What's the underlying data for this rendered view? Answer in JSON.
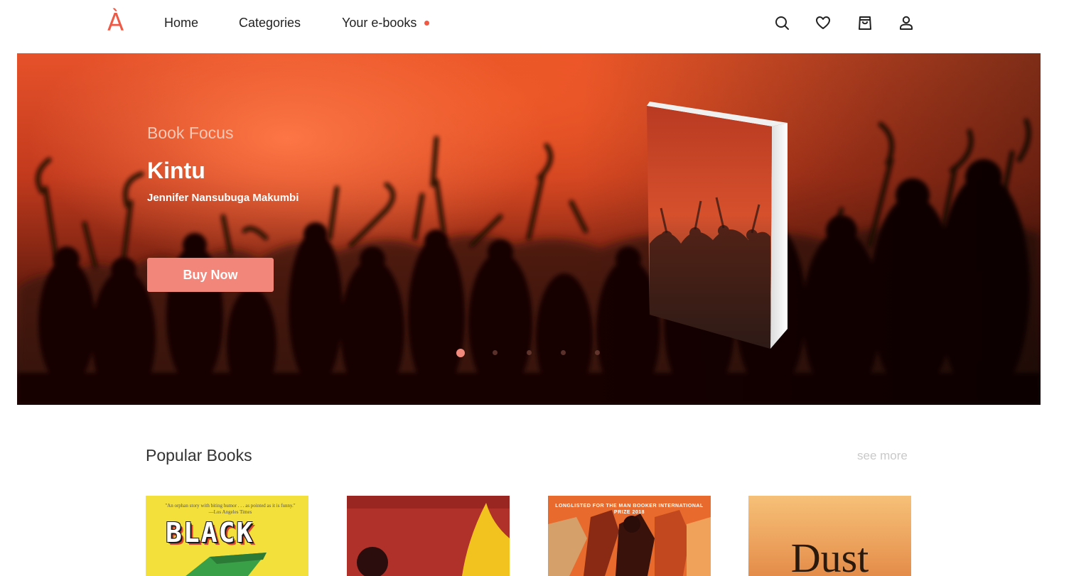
{
  "brand": {
    "logo_text": "À",
    "accent_color": "#ee5a46"
  },
  "nav": {
    "links": [
      {
        "label": "Home"
      },
      {
        "label": "Categories"
      },
      {
        "label": "Your e-books",
        "has_notification_dot": true
      }
    ],
    "icons": [
      "search-icon",
      "heart-icon",
      "shopping-bag-icon",
      "user-icon"
    ]
  },
  "hero": {
    "kicker": "Book Focus",
    "title": "Kintu",
    "author": "Jennifer Nansubuga Makumbi",
    "cta_label": "Buy Now",
    "cta_color": "#f3867a",
    "carousel": {
      "total_slides": 5,
      "active_slide": 1
    }
  },
  "popular": {
    "title": "Popular Books",
    "see_more": "see more",
    "books": [
      {
        "cover_quote": "\"An orphan story with biting humor . . . as pointed as it is funny.\" —Los Angeles Times",
        "cover_title": "BLACK"
      },
      {
        "cover_title": ""
      },
      {
        "cover_banner": "LONGLISTED FOR THE MAN BOOKER INTERNATIONAL PRIZE 2018"
      },
      {
        "cover_top": "",
        "cover_title": "Dust"
      }
    ]
  }
}
